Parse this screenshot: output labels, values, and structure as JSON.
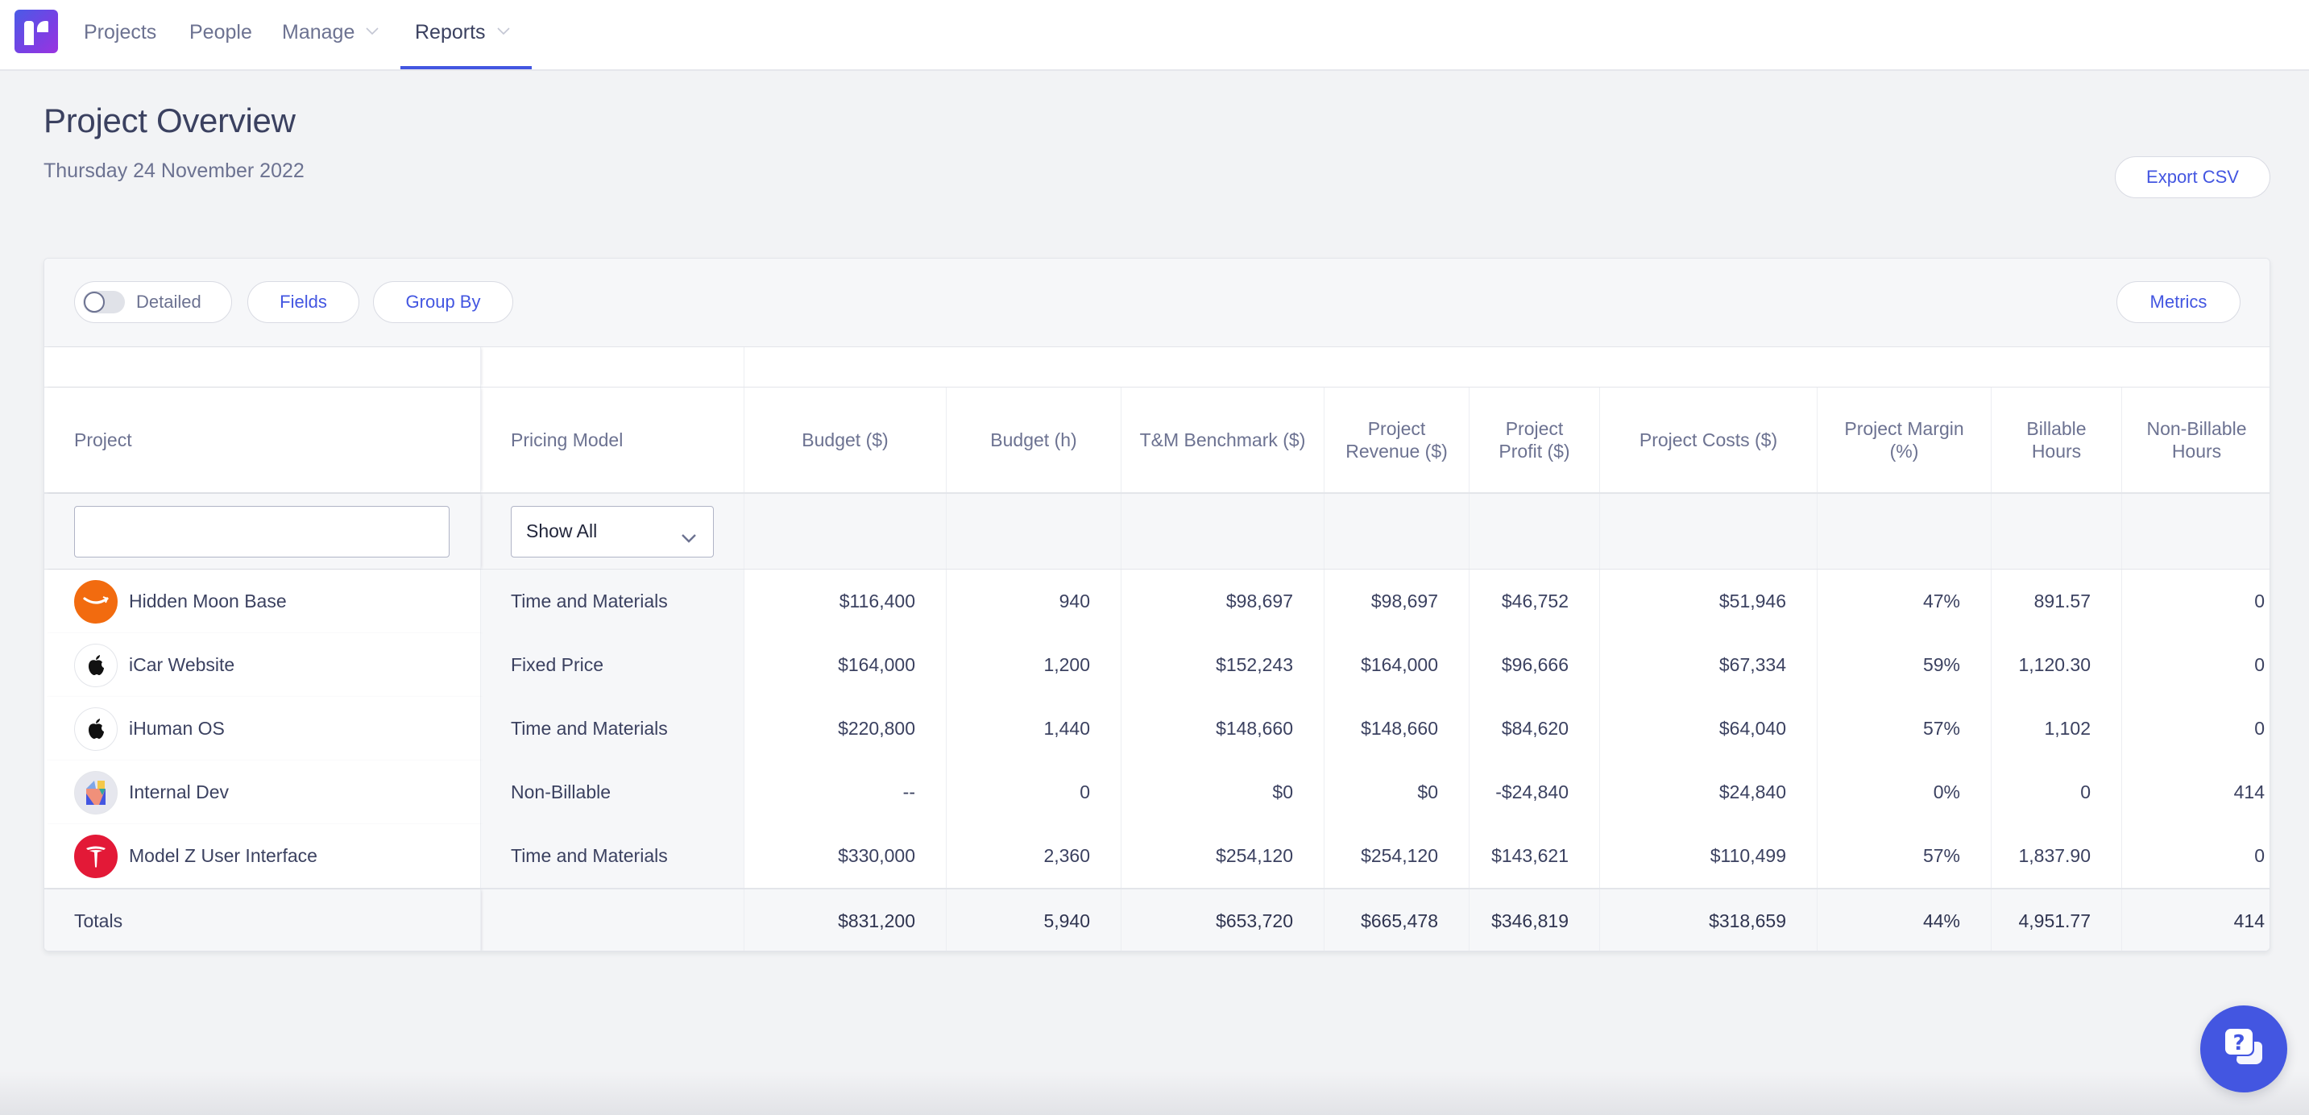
{
  "nav": {
    "items": [
      {
        "label": "Projects",
        "has_dropdown": false,
        "active": false
      },
      {
        "label": "People",
        "has_dropdown": false,
        "active": false
      },
      {
        "label": "Manage",
        "has_dropdown": true,
        "active": false
      },
      {
        "label": "Reports",
        "has_dropdown": true,
        "active": true
      }
    ]
  },
  "page": {
    "title": "Project Overview",
    "date": "Thursday 24 November 2022",
    "export_label": "Export CSV"
  },
  "toolbar": {
    "detailed_label": "Detailed",
    "detailed_on": false,
    "fields_label": "Fields",
    "group_by_label": "Group By",
    "metrics_label": "Metrics"
  },
  "table": {
    "columns": [
      "Project",
      "Pricing Model",
      "Budget ($)",
      "Budget (h)",
      "T&M Benchmark ($)",
      "Project Revenue ($)",
      "Project Profit ($)",
      "Project Costs ($)",
      "Project Margin (%)",
      "Billable Hours",
      "Non-Billable Hours"
    ],
    "filters": {
      "project_search_value": "",
      "pricing_model_selected": "Show All"
    },
    "rows": [
      {
        "project": "Hidden Moon Base",
        "icon": "amazon-logo-icon",
        "pricing": "Time and Materials",
        "values": [
          "$116,400",
          "940",
          "$98,697",
          "$98,697",
          "$46,752",
          "$51,946",
          "47%",
          "891.57",
          "0"
        ]
      },
      {
        "project": "iCar Website",
        "icon": "apple-logo-icon",
        "pricing": "Fixed Price",
        "values": [
          "$164,000",
          "1,200",
          "$152,243",
          "$164,000",
          "$96,666",
          "$67,334",
          "59%",
          "1,120.30",
          "0"
        ]
      },
      {
        "project": "iHuman OS",
        "icon": "apple-logo-icon",
        "pricing": "Time and Materials",
        "values": [
          "$220,800",
          "1,440",
          "$148,660",
          "$148,660",
          "$84,620",
          "$64,040",
          "57%",
          "1,102",
          "0"
        ]
      },
      {
        "project": "Internal Dev",
        "icon": "internal-logo-icon",
        "pricing": "Non-Billable",
        "values": [
          "--",
          "0",
          "$0",
          "$0",
          "-$24,840",
          "$24,840",
          "0%",
          "0",
          "414"
        ]
      },
      {
        "project": "Model Z User Interface",
        "icon": "tesla-logo-icon",
        "pricing": "Time and Materials",
        "values": [
          "$330,000",
          "2,360",
          "$254,120",
          "$254,120",
          "$143,621",
          "$110,499",
          "57%",
          "1,837.90",
          "0"
        ]
      }
    ],
    "totals": {
      "label": "Totals",
      "values": [
        "$831,200",
        "5,940",
        "$653,720",
        "$665,478",
        "$346,819",
        "$318,659",
        "44%",
        "4,951.77",
        "414"
      ]
    }
  },
  "colors": {
    "accent": "#4356e1",
    "amazon_orange": "#f26b0f",
    "tesla_red": "#e31937"
  },
  "help_button": {
    "icon": "help-chat-icon"
  }
}
